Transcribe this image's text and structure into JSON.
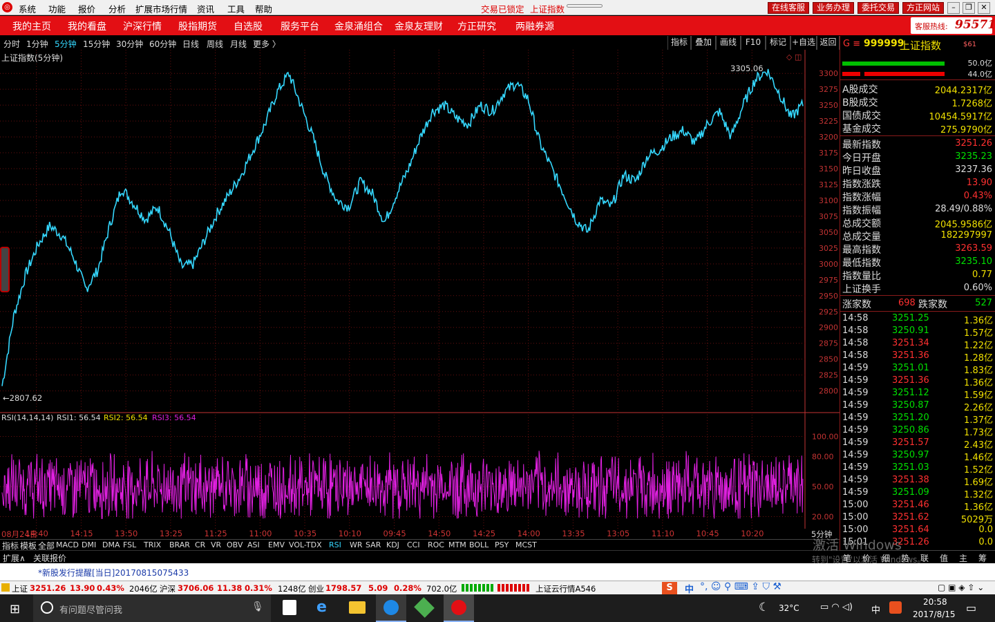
{
  "menubar": {
    "items": [
      "系统",
      "功能",
      "报价",
      "分析",
      "扩展市场行情",
      "资讯",
      "工具",
      "帮助"
    ],
    "lock_status": "交易已锁定",
    "current_index": "上证指数",
    "buttons": [
      "在线客服",
      "业务办理",
      "委托交易",
      "方正网站"
    ]
  },
  "navbar": {
    "items": [
      "我的主页",
      "我的看盘",
      "沪深行情",
      "股指期货",
      "自选股",
      "服务平台",
      "金泉涌组合",
      "金泉友理财",
      "方正研究",
      "两融券源"
    ],
    "hotline_label": "客服热线:",
    "hotline_number": "95571"
  },
  "periods": {
    "items": [
      "分时",
      "1分钟",
      "5分钟",
      "15分钟",
      "30分钟",
      "60分钟",
      "日线",
      "周线",
      "月线",
      "更多 〉"
    ],
    "selected": "5分钟"
  },
  "toolbar": {
    "items": [
      "指标",
      "叠加",
      "画线",
      "F10",
      "标记",
      "+自选",
      "返回"
    ]
  },
  "chart": {
    "title": "上证指数(5分钟)",
    "max_label": "3305.06",
    "min_label": "←2807.62",
    "rsi_params": "RSI(14,14,14)",
    "rsi1": "RSI1: 56.54",
    "rsi2": "RSI2: 56.54",
    "rsi3": "RSI3: 56.54",
    "colors": {
      "candle": "#35d8ff",
      "rsi": "#e020e0",
      "grid": "#6a0f0f",
      "axis": "#c33333"
    }
  },
  "chart_data": [
    {
      "type": "line",
      "title": "上证指数(5分钟)",
      "ylim": [
        2780,
        3310
      ],
      "yticks": [
        3300,
        3275,
        3250,
        3225,
        3200,
        3175,
        3150,
        3125,
        3100,
        3075,
        3050,
        3025,
        3000,
        2975,
        2950,
        2925,
        2900,
        2875,
        2850,
        2825,
        2800
      ],
      "x": [
        "08月24日",
        "14:40",
        "14:15",
        "13:50",
        "13:25",
        "11:25",
        "11:00",
        "10:35",
        "10:10",
        "09:45",
        "14:50",
        "14:25",
        "14:00",
        "13:35",
        "13:05",
        "11:10",
        "10:45",
        "10:20"
      ],
      "series": [
        {
          "values": [
            2807.62,
            2920,
            2985,
            3030,
            3060,
            3045,
            3010,
            2960,
            2990,
            3060,
            3120,
            3095,
            3070,
            3090,
            3050,
            2995,
            3000,
            3040,
            3080,
            3110,
            3140,
            3180,
            3220,
            3270,
            3300,
            3250,
            3200,
            3140,
            3100,
            3090,
            3130,
            3110,
            3065,
            3110,
            3150,
            3200,
            3240,
            3250,
            3230,
            3220,
            3250,
            3240,
            3270,
            3285,
            3260,
            3190,
            3150,
            3110,
            3070,
            3050,
            3100,
            3090,
            3140,
            3130,
            3170,
            3180,
            3200,
            3210,
            3190,
            3220,
            3240,
            3200,
            3250,
            3290,
            3305.06,
            3270,
            3230,
            3251.26
          ]
        }
      ]
    },
    {
      "type": "line",
      "title": "RSI(14,14,14)",
      "ylim": [
        10,
        110
      ],
      "yticks": [
        100.0,
        80.0,
        50.0,
        20.0
      ],
      "series": [
        {
          "name": "RSI1",
          "last": 56.54
        },
        {
          "name": "RSI2",
          "last": 56.54
        },
        {
          "name": "RSI3",
          "last": 56.54
        }
      ]
    }
  ],
  "x_axis": {
    "labels": [
      "08月24日",
      "14:40",
      "14:15",
      "13:50",
      "13:25",
      "11:25",
      "11:00",
      "10:35",
      "10:10",
      "09:45",
      "14:50",
      "14:25",
      "14:00",
      "13:35",
      "13:05",
      "11:10",
      "10:45",
      "10:20"
    ],
    "unit": "5分钟"
  },
  "indicator_tabs": {
    "items": [
      "指标",
      "模板",
      "全部",
      "MACD",
      "DMI",
      "DMA",
      "FSL",
      "TRIX",
      "BRAR",
      "CR",
      "VR",
      "OBV",
      "ASI",
      "EMV",
      "VOL-TDX",
      "RSI",
      "WR",
      "SAR",
      "KDJ",
      "CCI",
      "ROC",
      "MTM",
      "BOLL",
      "PSY",
      "MCST"
    ],
    "selected": "RSI"
  },
  "ext_bar": {
    "expand": "扩展∧",
    "related": "关联报价"
  },
  "right_panel": {
    "code_prefix": "G ≡",
    "code": "999999",
    "name": "上证指数",
    "tag": "$61",
    "bar1": "50.0亿",
    "bar2": "44.0亿",
    "turnover": [
      {
        "label": "A股成交",
        "value": "2044.2317亿"
      },
      {
        "label": "B股成交",
        "value": "1.7268亿"
      },
      {
        "label": "国债成交",
        "value": "10454.5917亿"
      },
      {
        "label": "基金成交",
        "value": "275.9790亿"
      }
    ],
    "stats": [
      {
        "label": "最新指数",
        "value": "3251.26",
        "color": "#ff3030"
      },
      {
        "label": "今日开盘",
        "value": "3235.23",
        "color": "#00e000"
      },
      {
        "label": "昨日收盘",
        "value": "3237.36",
        "color": "#dddddd"
      },
      {
        "label": "指数涨跌",
        "value": "13.90",
        "color": "#ff3030"
      },
      {
        "label": "指数涨幅",
        "value": "0.43%",
        "color": "#ff3030"
      },
      {
        "label": "指数振幅",
        "value": "28.49/0.88%",
        "color": "#dddddd"
      },
      {
        "label": "总成交额",
        "value": "2045.9586亿",
        "color": "#f0e000"
      },
      {
        "label": "总成交量",
        "value": "182297997",
        "color": "#f0e000"
      },
      {
        "label": "最高指数",
        "value": "3263.59",
        "color": "#ff3030"
      },
      {
        "label": "最低指数",
        "value": "3235.10",
        "color": "#00e000"
      },
      {
        "label": "指数量比",
        "value": "0.77",
        "color": "#f0e000"
      },
      {
        "label": "上证换手",
        "value": "0.60%",
        "color": "#dddddd"
      }
    ],
    "up_label": "涨家数",
    "up_count": "698",
    "down_label": "跌家数",
    "down_count": "527",
    "ticks": [
      {
        "time": "14:58",
        "price": "3251.25",
        "vol": "1.36亿"
      },
      {
        "time": "14:58",
        "price": "3250.91",
        "vol": "1.57亿"
      },
      {
        "time": "14:58",
        "price": "3251.34",
        "vol": "1.22亿"
      },
      {
        "time": "14:58",
        "price": "3251.36",
        "vol": "1.28亿"
      },
      {
        "time": "14:59",
        "price": "3251.01",
        "vol": "1.83亿"
      },
      {
        "time": "14:59",
        "price": "3251.36",
        "vol": "1.36亿"
      },
      {
        "time": "14:59",
        "price": "3251.12",
        "vol": "1.59亿"
      },
      {
        "time": "14:59",
        "price": "3250.87",
        "vol": "2.26亿"
      },
      {
        "time": "14:59",
        "price": "3251.20",
        "vol": "1.37亿"
      },
      {
        "time": "14:59",
        "price": "3250.86",
        "vol": "1.73亿"
      },
      {
        "time": "14:59",
        "price": "3251.57",
        "vol": "2.43亿"
      },
      {
        "time": "14:59",
        "price": "3250.97",
        "vol": "1.46亿"
      },
      {
        "time": "14:59",
        "price": "3251.03",
        "vol": "1.52亿"
      },
      {
        "time": "14:59",
        "price": "3251.38",
        "vol": "1.69亿"
      },
      {
        "time": "14:59",
        "price": "3251.09",
        "vol": "1.32亿"
      },
      {
        "time": "15:00",
        "price": "3251.46",
        "vol": "1.36亿"
      },
      {
        "time": "15:00",
        "price": "3251.62",
        "vol": "5029万"
      },
      {
        "time": "15:00",
        "price": "3251.64",
        "vol": "0.0"
      },
      {
        "time": "15:01",
        "price": "3251.26",
        "vol": "0.0"
      }
    ],
    "bottom_tabs": [
      "笔",
      "价",
      "细",
      "势",
      "联",
      "值",
      "主",
      "筹"
    ],
    "watermark1": "激活 Windows",
    "watermark2": "转到\"设置\"以激活 Windows。"
  },
  "news": {
    "text": "*新股发行提醒[当日]20170815075433"
  },
  "status": {
    "sh_label": "上证",
    "sh_value": "3251.26",
    "sh_change": "13.90",
    "sh_pct": "0.43%",
    "sh_amount": "2046亿",
    "hs_label": "沪深",
    "hs_value": "3706.06",
    "hs_change": "11.38",
    "hs_pct": "0.31%",
    "hs_amount": "1248亿",
    "cy_label": "创业",
    "cy_value": "1798.57",
    "cy_change": "5.09",
    "cy_pct": "0.28%",
    "cy_amount": "702.0亿",
    "server": "上证云行情A546",
    "ime": "中"
  },
  "taskbar": {
    "search_placeholder": "有问题尽管问我",
    "temperature": "32°C",
    "ime": "中",
    "time": "20:58",
    "date": "2017/8/15"
  }
}
